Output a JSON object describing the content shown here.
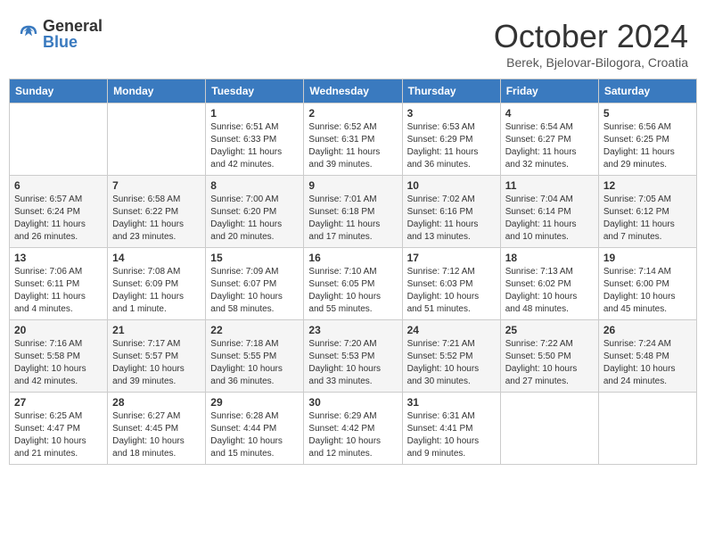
{
  "header": {
    "logo_general": "General",
    "logo_blue": "Blue",
    "month_title": "October 2024",
    "location": "Berek, Bjelovar-Bilogora, Croatia"
  },
  "days_of_week": [
    "Sunday",
    "Monday",
    "Tuesday",
    "Wednesday",
    "Thursday",
    "Friday",
    "Saturday"
  ],
  "weeks": [
    [
      {
        "day": "",
        "sunrise": "",
        "sunset": "",
        "daylight": ""
      },
      {
        "day": "",
        "sunrise": "",
        "sunset": "",
        "daylight": ""
      },
      {
        "day": "1",
        "sunrise": "Sunrise: 6:51 AM",
        "sunset": "Sunset: 6:33 PM",
        "daylight": "Daylight: 11 hours and 42 minutes."
      },
      {
        "day": "2",
        "sunrise": "Sunrise: 6:52 AM",
        "sunset": "Sunset: 6:31 PM",
        "daylight": "Daylight: 11 hours and 39 minutes."
      },
      {
        "day": "3",
        "sunrise": "Sunrise: 6:53 AM",
        "sunset": "Sunset: 6:29 PM",
        "daylight": "Daylight: 11 hours and 36 minutes."
      },
      {
        "day": "4",
        "sunrise": "Sunrise: 6:54 AM",
        "sunset": "Sunset: 6:27 PM",
        "daylight": "Daylight: 11 hours and 32 minutes."
      },
      {
        "day": "5",
        "sunrise": "Sunrise: 6:56 AM",
        "sunset": "Sunset: 6:25 PM",
        "daylight": "Daylight: 11 hours and 29 minutes."
      }
    ],
    [
      {
        "day": "6",
        "sunrise": "Sunrise: 6:57 AM",
        "sunset": "Sunset: 6:24 PM",
        "daylight": "Daylight: 11 hours and 26 minutes."
      },
      {
        "day": "7",
        "sunrise": "Sunrise: 6:58 AM",
        "sunset": "Sunset: 6:22 PM",
        "daylight": "Daylight: 11 hours and 23 minutes."
      },
      {
        "day": "8",
        "sunrise": "Sunrise: 7:00 AM",
        "sunset": "Sunset: 6:20 PM",
        "daylight": "Daylight: 11 hours and 20 minutes."
      },
      {
        "day": "9",
        "sunrise": "Sunrise: 7:01 AM",
        "sunset": "Sunset: 6:18 PM",
        "daylight": "Daylight: 11 hours and 17 minutes."
      },
      {
        "day": "10",
        "sunrise": "Sunrise: 7:02 AM",
        "sunset": "Sunset: 6:16 PM",
        "daylight": "Daylight: 11 hours and 13 minutes."
      },
      {
        "day": "11",
        "sunrise": "Sunrise: 7:04 AM",
        "sunset": "Sunset: 6:14 PM",
        "daylight": "Daylight: 11 hours and 10 minutes."
      },
      {
        "day": "12",
        "sunrise": "Sunrise: 7:05 AM",
        "sunset": "Sunset: 6:12 PM",
        "daylight": "Daylight: 11 hours and 7 minutes."
      }
    ],
    [
      {
        "day": "13",
        "sunrise": "Sunrise: 7:06 AM",
        "sunset": "Sunset: 6:11 PM",
        "daylight": "Daylight: 11 hours and 4 minutes."
      },
      {
        "day": "14",
        "sunrise": "Sunrise: 7:08 AM",
        "sunset": "Sunset: 6:09 PM",
        "daylight": "Daylight: 11 hours and 1 minute."
      },
      {
        "day": "15",
        "sunrise": "Sunrise: 7:09 AM",
        "sunset": "Sunset: 6:07 PM",
        "daylight": "Daylight: 10 hours and 58 minutes."
      },
      {
        "day": "16",
        "sunrise": "Sunrise: 7:10 AM",
        "sunset": "Sunset: 6:05 PM",
        "daylight": "Daylight: 10 hours and 55 minutes."
      },
      {
        "day": "17",
        "sunrise": "Sunrise: 7:12 AM",
        "sunset": "Sunset: 6:03 PM",
        "daylight": "Daylight: 10 hours and 51 minutes."
      },
      {
        "day": "18",
        "sunrise": "Sunrise: 7:13 AM",
        "sunset": "Sunset: 6:02 PM",
        "daylight": "Daylight: 10 hours and 48 minutes."
      },
      {
        "day": "19",
        "sunrise": "Sunrise: 7:14 AM",
        "sunset": "Sunset: 6:00 PM",
        "daylight": "Daylight: 10 hours and 45 minutes."
      }
    ],
    [
      {
        "day": "20",
        "sunrise": "Sunrise: 7:16 AM",
        "sunset": "Sunset: 5:58 PM",
        "daylight": "Daylight: 10 hours and 42 minutes."
      },
      {
        "day": "21",
        "sunrise": "Sunrise: 7:17 AM",
        "sunset": "Sunset: 5:57 PM",
        "daylight": "Daylight: 10 hours and 39 minutes."
      },
      {
        "day": "22",
        "sunrise": "Sunrise: 7:18 AM",
        "sunset": "Sunset: 5:55 PM",
        "daylight": "Daylight: 10 hours and 36 minutes."
      },
      {
        "day": "23",
        "sunrise": "Sunrise: 7:20 AM",
        "sunset": "Sunset: 5:53 PM",
        "daylight": "Daylight: 10 hours and 33 minutes."
      },
      {
        "day": "24",
        "sunrise": "Sunrise: 7:21 AM",
        "sunset": "Sunset: 5:52 PM",
        "daylight": "Daylight: 10 hours and 30 minutes."
      },
      {
        "day": "25",
        "sunrise": "Sunrise: 7:22 AM",
        "sunset": "Sunset: 5:50 PM",
        "daylight": "Daylight: 10 hours and 27 minutes."
      },
      {
        "day": "26",
        "sunrise": "Sunrise: 7:24 AM",
        "sunset": "Sunset: 5:48 PM",
        "daylight": "Daylight: 10 hours and 24 minutes."
      }
    ],
    [
      {
        "day": "27",
        "sunrise": "Sunrise: 6:25 AM",
        "sunset": "Sunset: 4:47 PM",
        "daylight": "Daylight: 10 hours and 21 minutes."
      },
      {
        "day": "28",
        "sunrise": "Sunrise: 6:27 AM",
        "sunset": "Sunset: 4:45 PM",
        "daylight": "Daylight: 10 hours and 18 minutes."
      },
      {
        "day": "29",
        "sunrise": "Sunrise: 6:28 AM",
        "sunset": "Sunset: 4:44 PM",
        "daylight": "Daylight: 10 hours and 15 minutes."
      },
      {
        "day": "30",
        "sunrise": "Sunrise: 6:29 AM",
        "sunset": "Sunset: 4:42 PM",
        "daylight": "Daylight: 10 hours and 12 minutes."
      },
      {
        "day": "31",
        "sunrise": "Sunrise: 6:31 AM",
        "sunset": "Sunset: 4:41 PM",
        "daylight": "Daylight: 10 hours and 9 minutes."
      },
      {
        "day": "",
        "sunrise": "",
        "sunset": "",
        "daylight": ""
      },
      {
        "day": "",
        "sunrise": "",
        "sunset": "",
        "daylight": ""
      }
    ]
  ]
}
